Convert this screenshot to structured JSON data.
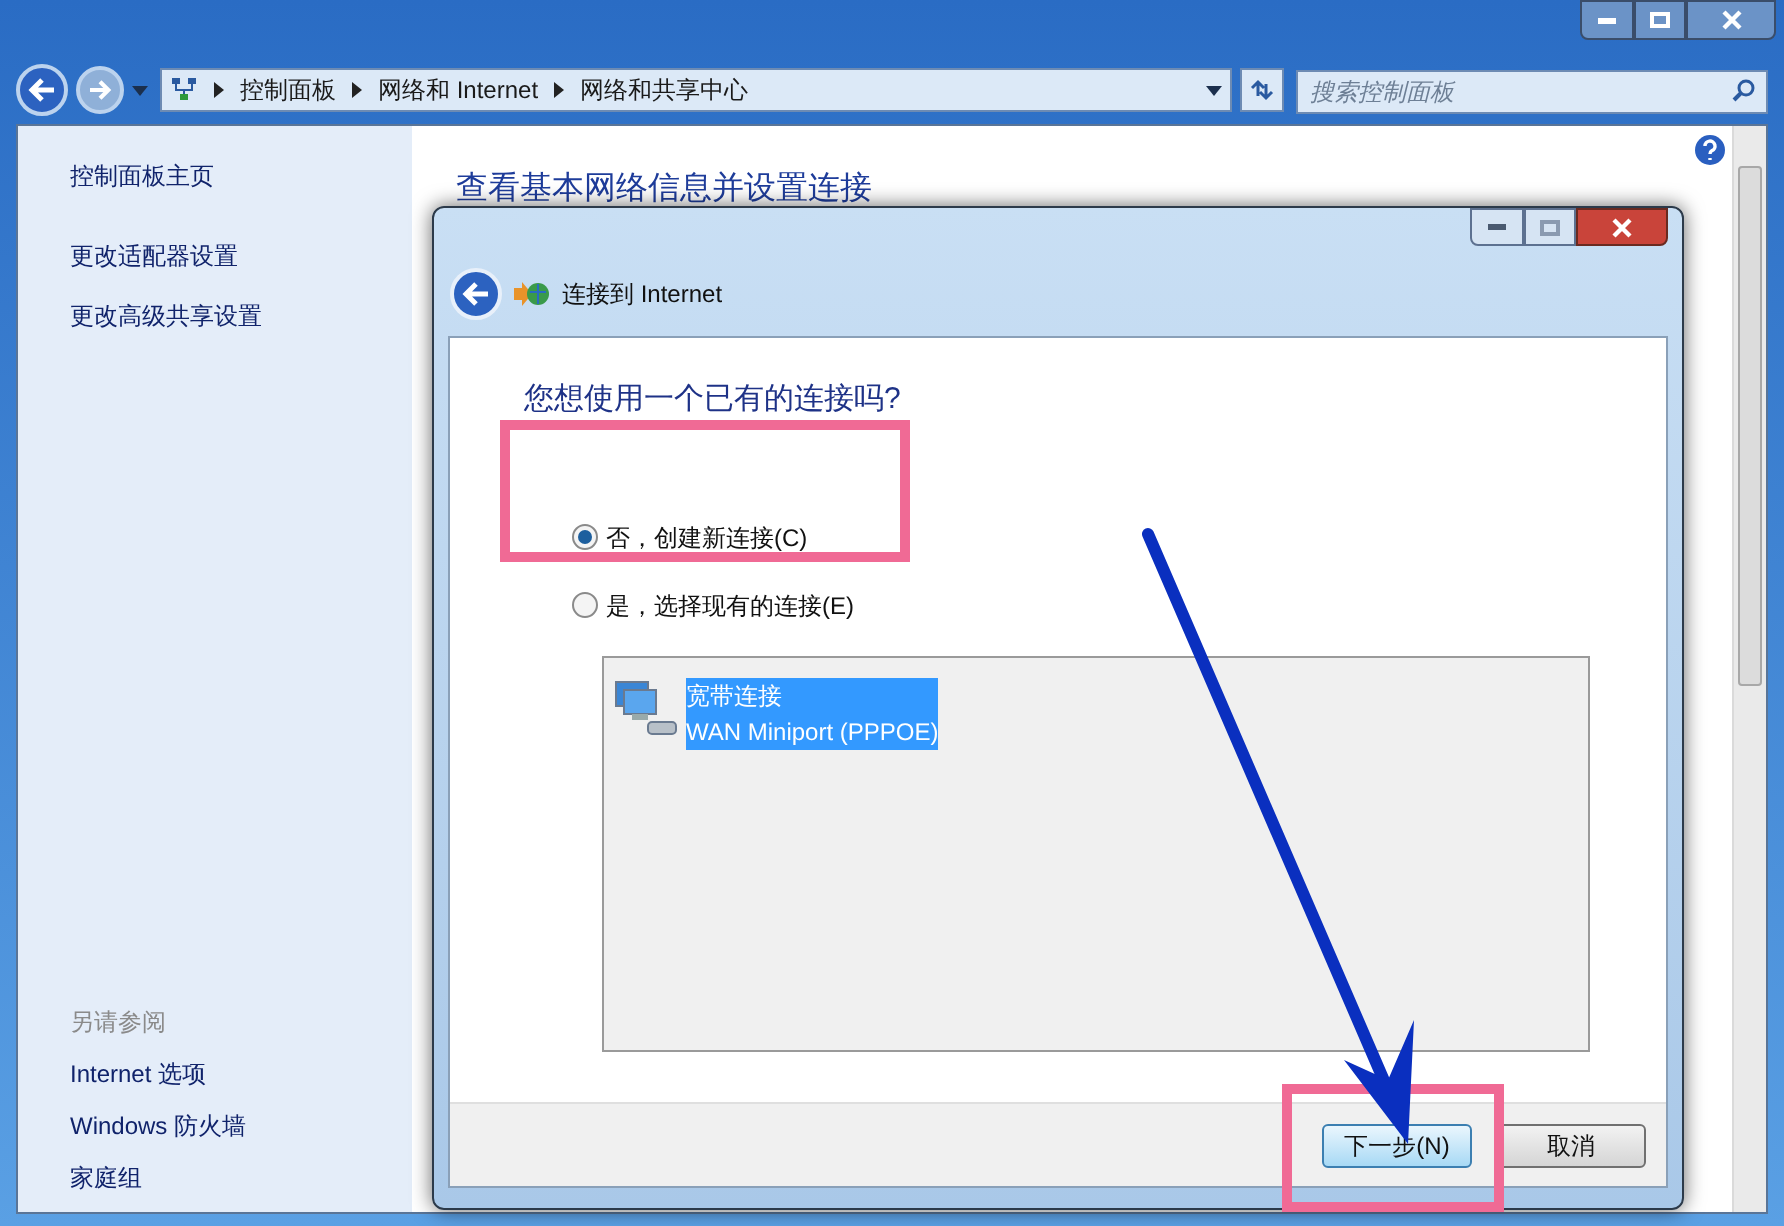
{
  "address_bar": {
    "crumbs": [
      "控制面板",
      "网络和 Internet",
      "网络和共享中心"
    ]
  },
  "search": {
    "placeholder": "搜索控制面板"
  },
  "sidebar": {
    "home": "控制面板主页",
    "items": [
      "更改适配器设置",
      "更改高级共享设置"
    ],
    "see_also_title": "另请参阅",
    "see_also": [
      "Internet 选项",
      "Windows 防火墙",
      "家庭组"
    ]
  },
  "main": {
    "title": "查看基本网络信息并设置连接"
  },
  "dialog": {
    "title": "连接到 Internet",
    "question": "您想使用一个已有的连接吗?",
    "options": [
      {
        "label": "否，创建新连接(C)",
        "selected": true
      },
      {
        "label": "是，选择现有的连接(E)",
        "selected": false
      }
    ],
    "connections": [
      {
        "name": "宽带连接",
        "device": "WAN Miniport (PPPOE)",
        "selected": true
      }
    ],
    "buttons": [
      {
        "label": "下一步(N)",
        "kind": "primary"
      },
      {
        "label": "取消",
        "kind": "normal"
      }
    ]
  },
  "annotations": [
    {
      "kind": "frame"
    },
    {
      "kind": "frame"
    },
    {
      "kind": "arrow"
    }
  ]
}
